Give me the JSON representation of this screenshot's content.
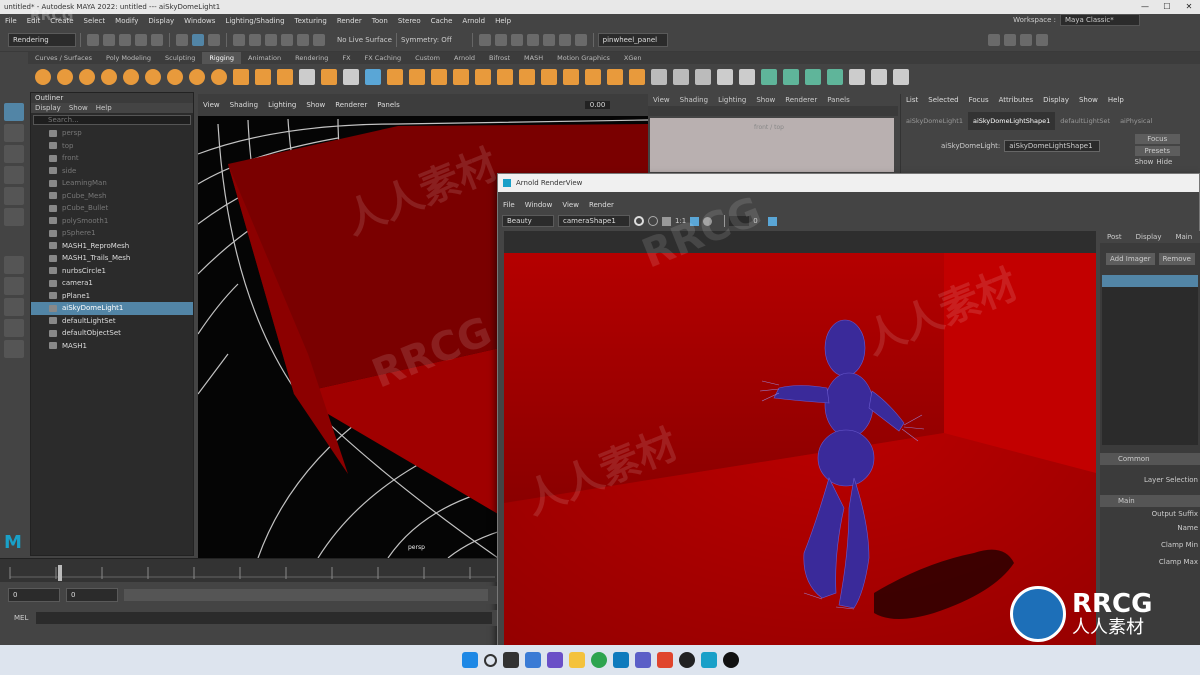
{
  "window": {
    "title": "untitled* - Autodesk MAYA 2022: untitled   ---   aiSkyDomeLight1",
    "controls": [
      "—",
      "☐",
      "✕"
    ]
  },
  "menubar": {
    "items": [
      "File",
      "Edit",
      "Create",
      "Select",
      "Modify",
      "Display",
      "Windows",
      "Lighting/Shading",
      "Texturing",
      "Render",
      "Toon",
      "Stereo",
      "Cache",
      "Arnold",
      "Help"
    ],
    "workspace_label": "Workspace :",
    "workspace_value": "Maya Classic*"
  },
  "statusline": {
    "mode": "Rendering",
    "live_surface": "No Live Surface",
    "symmetry": "Symmetry: Off",
    "camera_field": "pinwheel_panel"
  },
  "shelf": {
    "tabs": [
      "Curves / Surfaces",
      "Poly Modeling",
      "Sculpting",
      "Rigging",
      "Animation",
      "Rendering",
      "FX",
      "FX Caching",
      "Custom",
      "Arnold",
      "Bifrost",
      "MASH",
      "Motion Graphics",
      "XGen"
    ],
    "active_tab": 3
  },
  "outliner": {
    "title": "Outliner",
    "menus": [
      "Display",
      "Show",
      "Help"
    ],
    "search_placeholder": "Search...",
    "items": [
      {
        "label": "persp",
        "dim": true
      },
      {
        "label": "top",
        "dim": true
      },
      {
        "label": "front",
        "dim": true
      },
      {
        "label": "side",
        "dim": true
      },
      {
        "label": "LeamingMan",
        "dim": true
      },
      {
        "label": "pCube_Mesh",
        "dim": true
      },
      {
        "label": "pCube_Bullet",
        "dim": true
      },
      {
        "label": "polySmooth1",
        "dim": true
      },
      {
        "label": "pSphere1",
        "dim": true
      },
      {
        "label": "MASH1_ReproMesh",
        "dim": false
      },
      {
        "label": "MASH1_Trails_Mesh",
        "dim": false
      },
      {
        "label": "nurbsCircle1",
        "dim": false
      },
      {
        "label": "camera1",
        "dim": false
      },
      {
        "label": "pPlane1",
        "dim": false
      },
      {
        "label": "aiSkyDomeLight1",
        "dim": false,
        "selected": true
      },
      {
        "label": "defaultLightSet",
        "dim": false
      },
      {
        "label": "defaultObjectSet",
        "dim": false
      },
      {
        "label": "MASH1",
        "dim": false
      }
    ]
  },
  "viewport1": {
    "menus": [
      "View",
      "Shading",
      "Lighting",
      "Show",
      "Renderer",
      "Panels"
    ],
    "camera_label": "persp",
    "field_value": "0.00"
  },
  "viewport2": {
    "menus": [
      "View",
      "Shading",
      "Lighting",
      "Show",
      "Renderer",
      "Panels"
    ],
    "label": "front / top"
  },
  "attribute_editor": {
    "menus": [
      "List",
      "Selected",
      "Focus",
      "Attributes",
      "Display",
      "Show",
      "Help"
    ],
    "tabs": [
      "aiSkyDomeLight1",
      "aiSkyDomeLightShape1",
      "defaultLightSet",
      "aiPhysical"
    ],
    "field_label": "aiSkyDomeLight:",
    "field_value": "aiSkyDomeLightShape1",
    "buttons": [
      "Focus",
      "Presets",
      "Show",
      "Hide"
    ]
  },
  "render_view": {
    "title": "Arnold RenderView",
    "menus": [
      "File",
      "Window",
      "View",
      "Render"
    ],
    "aov": "Beauty",
    "camera": "cameraShape1",
    "ratio": "1:1",
    "value": "0",
    "side_tabs": [
      "Post",
      "Display",
      "Main"
    ],
    "add_imager": "Add Imager",
    "remove": "Remove",
    "sections": [
      "Common",
      "Main"
    ],
    "props": [
      "Layer Selection",
      "Output Suffix",
      "Name",
      "Clamp Min",
      "Clamp Max"
    ]
  },
  "timeline": {
    "start": "0",
    "end": "0",
    "range_start": "0",
    "range_end": "0"
  },
  "mel": {
    "label": "MEL"
  },
  "watermark": {
    "text1": "RRCG",
    "text2": "人人素材",
    "logo_text": "RRCG",
    "logo_sub": "人人素材"
  },
  "colors": {
    "accent_select": "#5285a6",
    "render_red": "#b00000",
    "maya_bg": "#444444"
  }
}
